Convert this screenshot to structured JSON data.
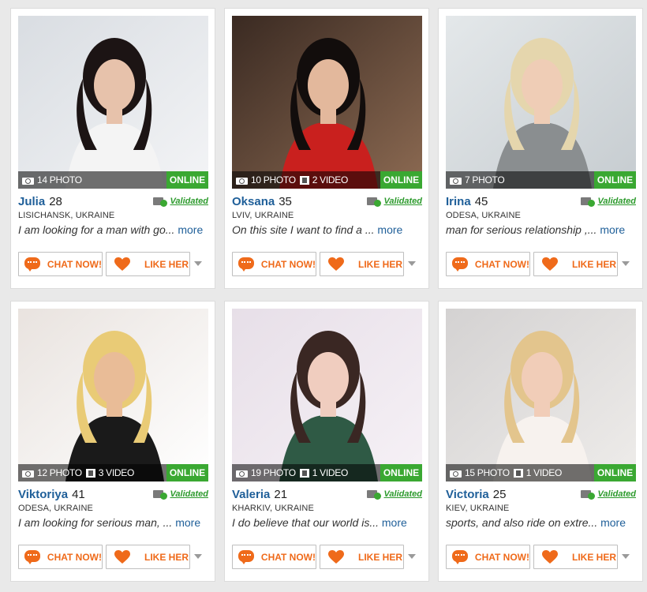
{
  "colors": {
    "accent": "#ef6a1a",
    "name": "#1f5f99",
    "online": "#3aa832",
    "validated": "#2c9a2c"
  },
  "labels": {
    "online": "ONLINE",
    "validated": "Validated",
    "chat": "CHAT NOW!",
    "like": "LIKE HER",
    "more": "more"
  },
  "profiles": [
    {
      "name": "Julia",
      "age": "28",
      "photos": "14 PHOTO",
      "videos": "",
      "location": "LISICHANSK, UKRAINE",
      "bio": "I am looking for a man with go...",
      "online": true
    },
    {
      "name": "Oksana",
      "age": "35",
      "photos": "10 PHOTO",
      "videos": "2 VIDEO",
      "location": "LVIV, UKRAINE",
      "bio": "On this site I want to find a ...",
      "online": true
    },
    {
      "name": "Irina",
      "age": "45",
      "photos": "7 PHOTO",
      "videos": "",
      "location": "ODESA, UKRAINE",
      "bio": "man for serious relationship ,...",
      "online": true
    },
    {
      "name": "Viktoriya",
      "age": "41",
      "photos": "12 PHOTO",
      "videos": "3 VIDEO",
      "location": "ODESA, UKRAINE",
      "bio": "I am looking for serious man, ...",
      "online": true
    },
    {
      "name": "Valeria",
      "age": "21",
      "photos": "19 PHOTO",
      "videos": "1 VIDEO",
      "location": "KHARKIV, UKRAINE",
      "bio": "I do believe that our world is...",
      "online": true
    },
    {
      "name": "Victoria",
      "age": "25",
      "photos": "15 PHOTO",
      "videos": "1 VIDEO",
      "location": "KIEV, UKRAINE",
      "bio": "sports, and also ride on extre...",
      "online": true
    }
  ]
}
